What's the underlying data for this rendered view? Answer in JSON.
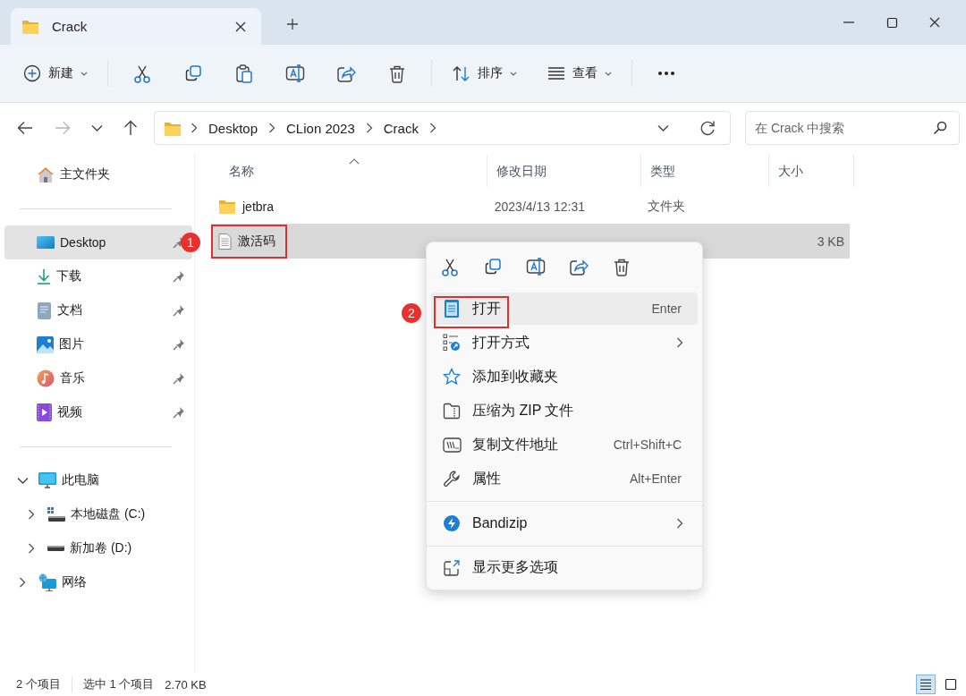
{
  "window": {
    "tabs": [
      {
        "label": "Crack",
        "selected": true
      }
    ]
  },
  "toolbar": {
    "new_label": "新建",
    "sort_label": "排序",
    "view_label": "查看"
  },
  "navigation": [
    {
      "disabled": false
    },
    {
      "disabled": true
    },
    {
      "disabled": false
    },
    {
      "disabled": false
    }
  ],
  "address": {
    "path": [
      "Desktop",
      "CLion 2023",
      "Crack"
    ]
  },
  "search": {
    "placeholder": "在 Crack 中搜索"
  },
  "sidebar": {
    "quick_access": [
      {
        "label": "主文件夹",
        "pinned": false,
        "selected": false
      },
      {
        "label": "Desktop",
        "pinned": true,
        "selected": true
      },
      {
        "label": "下载",
        "pinned": true,
        "selected": false
      },
      {
        "label": "文档",
        "pinned": true,
        "selected": false
      },
      {
        "label": "图片",
        "pinned": true,
        "selected": false
      },
      {
        "label": "音乐",
        "pinned": true,
        "selected": false
      },
      {
        "label": "视频",
        "pinned": true,
        "selected": false
      }
    ],
    "tree": [
      {
        "label": "此电脑",
        "expanded": true,
        "children": [
          {
            "label": "本地磁盘 (C:)",
            "expanded": false
          },
          {
            "label": "新加卷 (D:)",
            "expanded": false
          }
        ]
      },
      {
        "label": "网络",
        "expanded": false
      }
    ]
  },
  "table": {
    "columns": [
      "名称",
      "修改日期",
      "类型",
      "大小"
    ],
    "rows": [
      {
        "kind": "folder",
        "name": "jetbra",
        "modified": "2023/4/13 12:31",
        "type": "文件夹",
        "selected": false
      },
      {
        "kind": "text",
        "name": "激活码",
        "size": "3 KB",
        "selected": true
      }
    ]
  },
  "context_menu": {
    "groups": [
      [
        {
          "label": "打开",
          "shortcut": "Enter",
          "submenu": false,
          "highlighted": true
        },
        {
          "label": "打开方式",
          "submenu": true,
          "highlighted": false
        },
        {
          "label": "添加到收藏夹",
          "submenu": false,
          "highlighted": false
        },
        {
          "label": "压缩为 ZIP 文件",
          "submenu": false,
          "highlighted": false
        },
        {
          "label": "复制文件地址",
          "shortcut": "Ctrl+Shift+C",
          "submenu": false,
          "highlighted": false
        },
        {
          "label": "属性",
          "shortcut": "Alt+Enter",
          "submenu": false,
          "highlighted": false
        }
      ],
      [
        {
          "label": "Bandizip",
          "submenu": true,
          "highlighted": false
        }
      ],
      [
        {
          "label": "显示更多选项",
          "submenu": false,
          "highlighted": false
        }
      ]
    ]
  },
  "annotations": [
    {
      "number": "1",
      "boxed": true
    },
    {
      "number": "2",
      "boxed": true
    }
  ],
  "status_bar": {
    "items": [
      "2 个项目",
      "选中 1 个项目",
      "2.70 KB"
    ],
    "views": [
      {
        "selected": true
      },
      {
        "selected": false
      }
    ]
  }
}
